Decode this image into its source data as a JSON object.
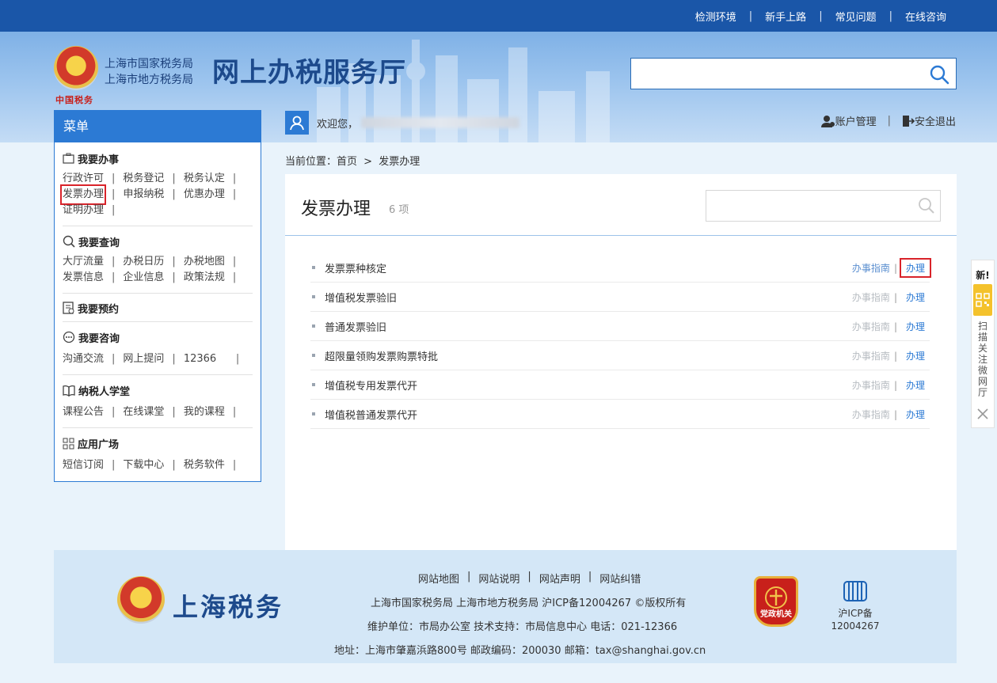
{
  "top_nav": [
    "检测环境",
    "新手上路",
    "常见问题",
    "在线咨询"
  ],
  "top_nav_sep": "|",
  "header": {
    "bureau_lines": [
      "上海市国家税务局",
      "上海市地方税务局"
    ],
    "hall_title": "网上办税服务厅",
    "emblem_caption": "中国税务",
    "search_placeholder": ""
  },
  "welcome": {
    "text": "欢迎您，"
  },
  "account": {
    "manage": "账户管理",
    "sep": "|",
    "logout": "安全退出"
  },
  "menu": {
    "title": "菜单",
    "sections": [
      {
        "title": "我要办事",
        "icon": "briefcase-icon",
        "rows": [
          [
            "行政许可",
            "税务登记",
            "税务认定"
          ],
          [
            "发票办理",
            "申报纳税",
            "优惠办理"
          ],
          [
            "证明办理"
          ]
        ]
      },
      {
        "title": "我要查询",
        "icon": "search-icon",
        "rows": [
          [
            "大厅流量",
            "办税日历",
            "办税地图"
          ],
          [
            "发票信息",
            "企业信息",
            "政策法规"
          ]
        ]
      },
      {
        "title": "我要预约",
        "icon": "appointment-icon",
        "rows": []
      },
      {
        "title": "我要咨询",
        "icon": "chat-icon",
        "rows": [
          [
            "沟通交流",
            "网上提问",
            "12366"
          ]
        ]
      },
      {
        "title": "纳税人学堂",
        "icon": "book-icon",
        "rows": [
          [
            "课程公告",
            "在线课堂",
            "我的课程"
          ]
        ]
      },
      {
        "title": "应用广场",
        "icon": "apps-icon",
        "rows": [
          [
            "短信订阅",
            "下载中心",
            "税务软件"
          ]
        ]
      }
    ],
    "sep": "|"
  },
  "breadcrumb": {
    "label": "当前位置：",
    "home": "首页",
    "arrow": ">",
    "current": "发票办理"
  },
  "panel": {
    "title": "发票办理",
    "count": "6 项",
    "search_placeholder": "",
    "guide_label": "办事指南",
    "do_label": "办理",
    "sep": "|",
    "items": [
      "发票票种核定",
      "增值税发票验旧",
      "普通发票验旧",
      "超限量领购发票购票特批",
      "增值税专用发票代开",
      "增值税普通发票代开"
    ]
  },
  "float_widget": {
    "new_label": "新!",
    "vertical_text": "扫描关注微网厅"
  },
  "footer": {
    "brand": "上海税务",
    "links": [
      "网站地图",
      "网站说明",
      "网站声明",
      "网站纠错"
    ],
    "sep": "|",
    "line1": "上海市国家税务局 上海市地方税务局 沪ICP备12004267 ©版权所有",
    "line2": "维护单位：市局办公室   技术支持：市局信息中心 电话：021-12366",
    "line3": "地址：上海市肇嘉浜路800号   邮政编码：200030   邮箱：tax@shanghai.gov.cn",
    "badge_text": "党政机关",
    "icp_label": "沪ICP备",
    "icp_number": "12004267"
  },
  "colors": {
    "top_bar": "#1a56a8",
    "accent": "#2c7ad4",
    "highlight": "#d9232a",
    "footer_bg": "#d4e7f7"
  }
}
